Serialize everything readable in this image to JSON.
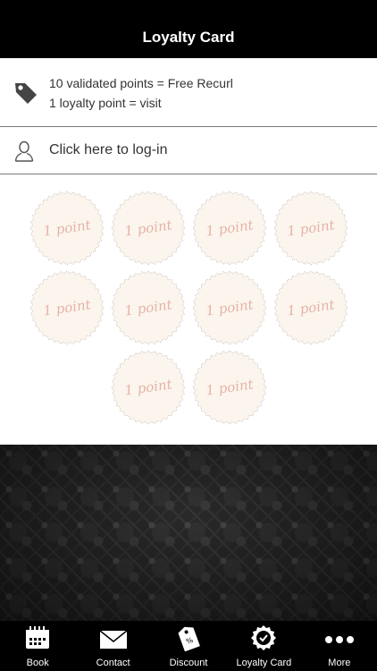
{
  "navbar": {
    "title": "Loyalty Card"
  },
  "info": {
    "icon": "price-tag-icon",
    "line1": "10 validated points = Free Recurl",
    "line2": "1 loyalty point = visit"
  },
  "login": {
    "icon": "user-icon",
    "label": "Click here to log-in"
  },
  "stamps": {
    "total": 10,
    "collected": 0,
    "items": [
      {
        "label": "1 point"
      },
      {
        "label": "1 point"
      },
      {
        "label": "1 point"
      },
      {
        "label": "1 point"
      },
      {
        "label": "1 point"
      },
      {
        "label": "1 point"
      },
      {
        "label": "1 point"
      },
      {
        "label": "1 point"
      },
      {
        "label": "1 point"
      },
      {
        "label": "1 point"
      }
    ]
  },
  "tabbar": {
    "items": [
      {
        "label": "Book",
        "icon": "calendar-icon"
      },
      {
        "label": "Contact",
        "icon": "envelope-icon"
      },
      {
        "label": "Discount",
        "icon": "discount-tag-icon"
      },
      {
        "label": "Loyalty Card",
        "icon": "badge-check-icon"
      },
      {
        "label": "More",
        "icon": "more-dots-icon"
      }
    ]
  },
  "colors": {
    "navbar_bg": "#000000",
    "stamp_fill": "#fbf5ee",
    "stamp_text": "#e6b3a6",
    "divider": "#7a7a7a"
  }
}
